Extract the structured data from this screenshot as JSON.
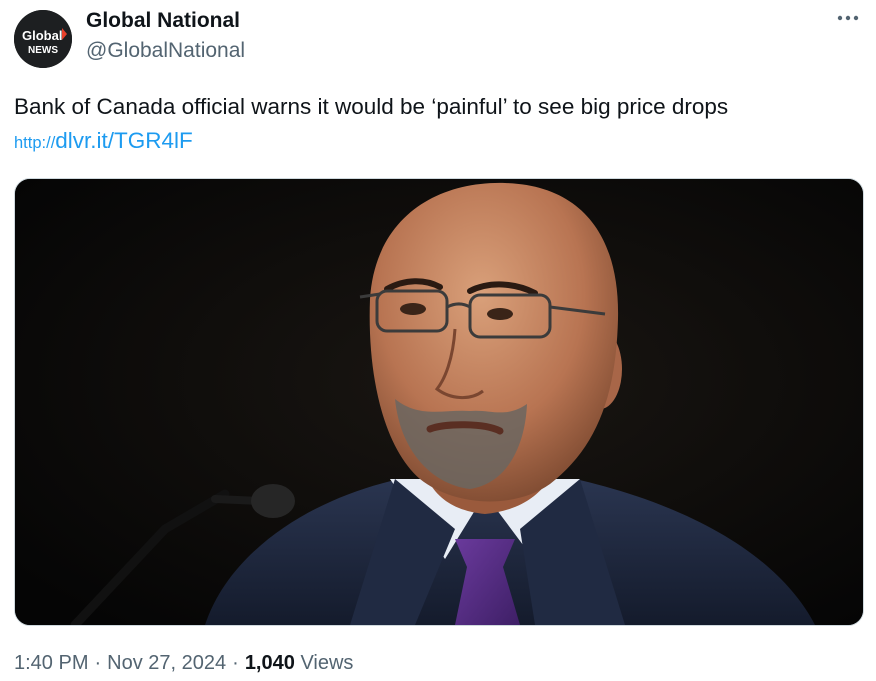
{
  "account": {
    "display_name": "Global National",
    "handle": "@GlobalNational",
    "avatar_text_top": "Global",
    "avatar_text_bottom": "NEWS",
    "avatar_icon": "global-news-logo",
    "avatar_bg": "#1d1f21",
    "avatar_accent": "#e8412c"
  },
  "menu": {
    "more_icon": "more-horizontal-icon"
  },
  "tweet": {
    "text": "Bank of Canada official warns it would be ‘painful’ to see big price drops",
    "link_protocol": "http://",
    "link_text": "dlvr.it/TGR4lF",
    "link_color": "#1d9bf0"
  },
  "media": {
    "type": "photo"
  },
  "meta": {
    "time": "1:40 PM",
    "date": "Nov 27, 2024",
    "separator": "·",
    "views_count": "1,040",
    "views_label": "Views"
  },
  "colors": {
    "text_primary": "#0f1419",
    "text_secondary": "#536471",
    "border": "#cfd9de"
  }
}
